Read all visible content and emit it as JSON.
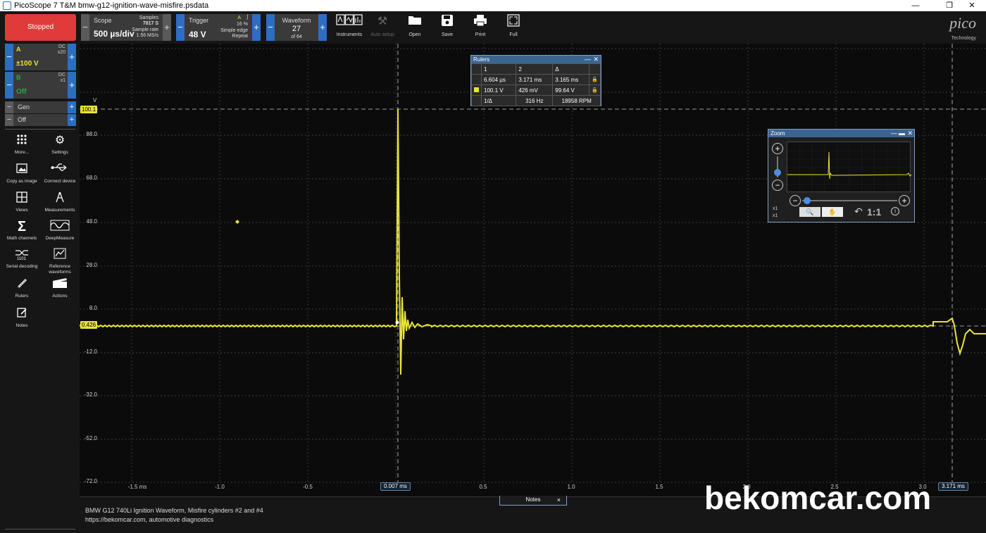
{
  "window": {
    "title": "PicoScope 7 T&M bmw-g12-ignition-wave-misfire.psdata",
    "min": "—",
    "restore": "❐",
    "close": "✕"
  },
  "toolbar": {
    "run_state": "Stopped",
    "scope": {
      "label": "Scope",
      "timebase": "500 µs/div",
      "samples_label": "Samples",
      "samples": "7817 S",
      "rate_label": "Sample rate",
      "rate": "1.56 MS/s"
    },
    "trigger": {
      "label": "Trigger",
      "level": "48 V",
      "channel": "A",
      "pre": "16 %",
      "type": "Simple edge",
      "mode": "Repeat"
    },
    "waveform": {
      "label": "Waveform",
      "index": "27",
      "of": "of 64"
    },
    "buttons": [
      {
        "label": "Instruments",
        "icon": "instruments-icon"
      },
      {
        "label": "Auto setup",
        "icon": "wand-icon",
        "disabled": true
      },
      {
        "label": "Open",
        "icon": "folder-icon"
      },
      {
        "label": "Save",
        "icon": "save-icon"
      },
      {
        "label": "Print",
        "icon": "print-icon"
      },
      {
        "label": "Full",
        "icon": "fullscreen-icon"
      }
    ],
    "logo": "pico",
    "logo_sub": "Technology"
  },
  "channels": [
    {
      "letter": "A",
      "coupling": "DC",
      "probe": "x20",
      "range": "±100 V",
      "color": "#e8e33a"
    },
    {
      "letter": "B",
      "coupling": "DC",
      "probe": "x1",
      "range": "Off",
      "color": "#2aa64a"
    }
  ],
  "generator": [
    {
      "label": "Gen"
    },
    {
      "label": "Off"
    }
  ],
  "sidebar": [
    {
      "label": "More...",
      "icon": "grid-dots-icon"
    },
    {
      "label": "Settings",
      "icon": "gear-icon"
    },
    {
      "label": "Copy as image",
      "icon": "image-icon"
    },
    {
      "label": "Connect device",
      "icon": "usb-icon"
    },
    {
      "label": "Views",
      "icon": "views-icon"
    },
    {
      "label": "Measurements",
      "icon": "compass-icon"
    },
    {
      "label": "Math channels",
      "icon": "sigma-icon"
    },
    {
      "label": "DeepMeasure",
      "icon": "deepmeasure-icon"
    },
    {
      "label": "Serial decoding",
      "icon": "serial-icon"
    },
    {
      "label": "Reference waveforms",
      "icon": "reference-icon"
    },
    {
      "label": "Rulers",
      "icon": "ruler-icon"
    },
    {
      "label": "Actions",
      "icon": "clapper-icon"
    },
    {
      "label": "Notes",
      "icon": "notes-icon"
    }
  ],
  "plot": {
    "y_unit": "V",
    "y_ticks": [
      "88.0",
      "68.0",
      "48.0",
      "28.0",
      "8.0",
      "-12.0",
      "-32.0",
      "-52.0",
      "-72.0"
    ],
    "x_ticks": [
      "-1.5 ms",
      "-1.0",
      "-0.5",
      "0.5",
      "1.0",
      "1.5",
      "2.0",
      "2.5",
      "3.0"
    ],
    "ruler_y_tags": [
      "100.1",
      "0.426"
    ],
    "ruler_x_tags": [
      "0.007 ms",
      "3.171 ms"
    ],
    "trace_color": "#e8e33a"
  },
  "rulers_panel": {
    "title": "Rulers",
    "header": [
      "",
      "1",
      "2",
      "Δ"
    ],
    "time_row": [
      "6.604 µs",
      "3.171 ms",
      "3.165 ms"
    ],
    "volt_row": [
      "100.1 V",
      "426 mV",
      "99.64 V"
    ],
    "freq_row": [
      "1/Δ",
      "316 Hz",
      "18958 RPM"
    ]
  },
  "zoom_panel": {
    "title": "Zoom",
    "x_label_1": "x1",
    "x_label_2": "x1",
    "reset": "1:1"
  },
  "notes": {
    "tab": "Notes",
    "line1": "BMW G12 740Li Ignition Waveform, Misfire cylinders #2 and #4",
    "line2": "https://bekomcar.com, automotive diagnostics"
  },
  "watermark": "bekomcar.com"
}
